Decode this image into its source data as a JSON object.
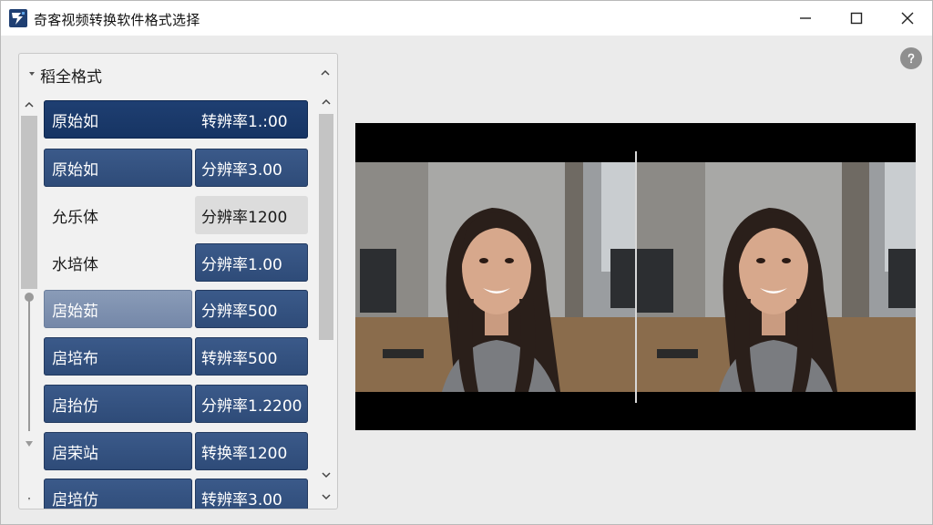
{
  "window": {
    "title": "奇客视频转换软件格式选择",
    "icons": {
      "logo": "app-logo-icon",
      "minimize": "minimize-icon",
      "maximize": "maximize-icon",
      "close": "close-icon",
      "help": "help-icon"
    }
  },
  "panel": {
    "title": "稻全格式",
    "rows": [
      {
        "name": "原始如",
        "resolution": "转辨率1.:00",
        "name_style": "selected",
        "res_style": "selected"
      },
      {
        "name": "原始如",
        "resolution": "分辨率3.00",
        "name_style": "blue",
        "res_style": "blue"
      },
      {
        "name": "允乐体",
        "resolution": "分辨率1200",
        "name_style": "plain",
        "res_style": "gray"
      },
      {
        "name": "水培体",
        "resolution": "分辨率1.00",
        "name_style": "plain",
        "res_style": "blue"
      },
      {
        "name": "扂始茹",
        "resolution": "分辨率500",
        "name_style": "blue-light",
        "res_style": "blue"
      },
      {
        "name": "扂培布",
        "resolution": "转辨率500",
        "name_style": "blue",
        "res_style": "blue"
      },
      {
        "name": "扂抬仿",
        "resolution": "分辨率1.2200",
        "name_style": "blue",
        "res_style": "blue"
      },
      {
        "name": "扂荣站",
        "resolution": "转换率1200",
        "name_style": "blue",
        "res_style": "blue"
      },
      {
        "name": "扂培仿",
        "resolution": "转辨率3.00",
        "name_style": "blue",
        "res_style": "blue"
      }
    ]
  },
  "preview": {
    "left_label": "original-frame",
    "right_label": "converted-frame"
  }
}
